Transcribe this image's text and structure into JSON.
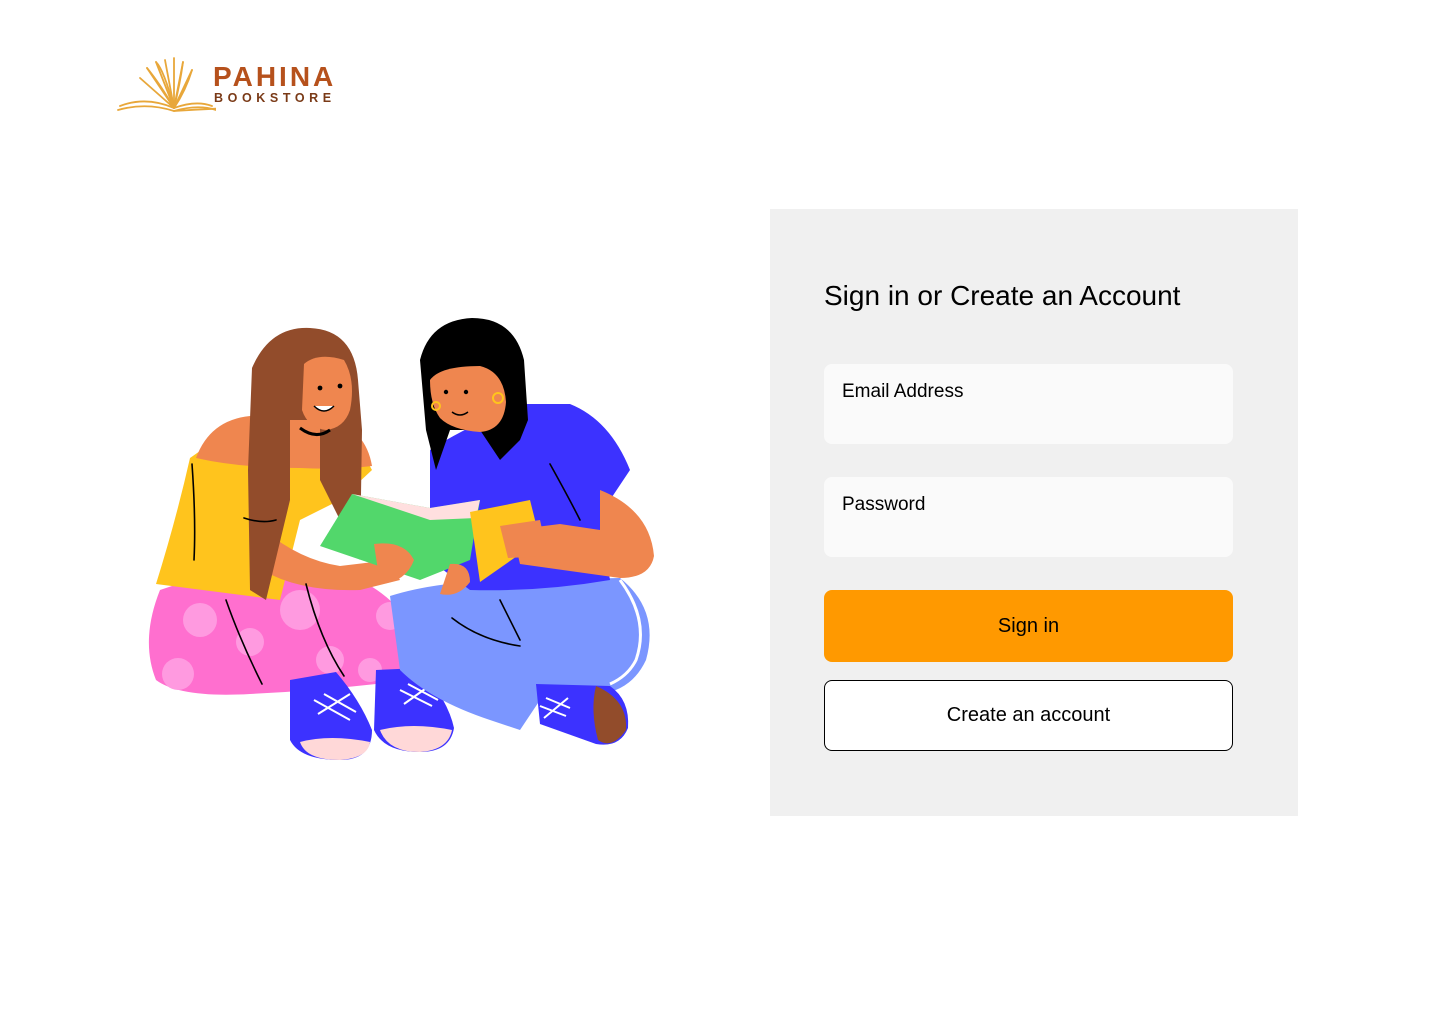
{
  "brand": {
    "name": "PAHINA",
    "tagline": "BOOKSTORE",
    "logo_icon": "open-book-icon",
    "colors": {
      "primary": "#b6511c",
      "secondary": "#7a3a17",
      "icon": "#e8a73a"
    }
  },
  "illustration": {
    "icon": "two-people-reading-book-illustration"
  },
  "signin_panel": {
    "title": "Sign in or Create an Account",
    "email": {
      "label": "Email Address",
      "value": ""
    },
    "password": {
      "label": "Password",
      "value": ""
    },
    "signin_button": "Sign in",
    "create_account_button": "Create an account",
    "colors": {
      "panel_bg": "#f0f0f0",
      "field_bg": "#fafafa",
      "signin_bg": "#ff9900"
    }
  }
}
